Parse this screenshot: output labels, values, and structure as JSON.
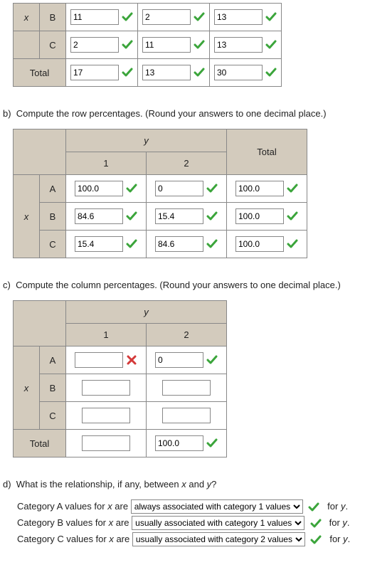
{
  "top_table": {
    "row_x": "x",
    "B": "B",
    "C": "C",
    "Total": "Total",
    "B1": "11",
    "B2": "2",
    "B3": "13",
    "C1": "2",
    "C2": "11",
    "C3": "13",
    "T1": "17",
    "T2": "13",
    "T3": "30"
  },
  "partB": {
    "label": "b)",
    "prompt": "Compute the row percentages. (Round your answers to one decimal place.)",
    "y": "y",
    "c1": "1",
    "c2": "2",
    "total": "Total",
    "x": "x",
    "A": "A",
    "B": "B",
    "C": "C",
    "A1": "100.0",
    "A2": "0",
    "AT": "100.0",
    "B1": "84.6",
    "B2": "15.4",
    "BT": "100.0",
    "C1": "15.4",
    "C2": "84.6",
    "CT": "100.0"
  },
  "partC": {
    "label": "c)",
    "prompt": "Compute the column percentages. (Round your answers to one decimal place.)",
    "y": "y",
    "c1": "1",
    "c2": "2",
    "x": "x",
    "A": "A",
    "B": "B",
    "C": "C",
    "Total": "Total",
    "A1": "",
    "A2": "0",
    "B1": "",
    "B2": "",
    "C1": "",
    "C2": "",
    "T1": "",
    "T2": "100.0"
  },
  "partD": {
    "label": "d)",
    "prompt_prefix": "What is the relationship, if any, between ",
    "xvar": "x",
    "and": " and ",
    "yvar": "y",
    "q": "?",
    "catA_pre": "Category A values for ",
    "catB_pre": "Category B values for ",
    "catC_pre": "Category C values for ",
    "are": " are ",
    "optA": "always associated with category 1 values",
    "optB": "usually associated with category 1 values",
    "optC": "usually associated with category 2 values",
    "for": "for ",
    "ydot": "y."
  }
}
